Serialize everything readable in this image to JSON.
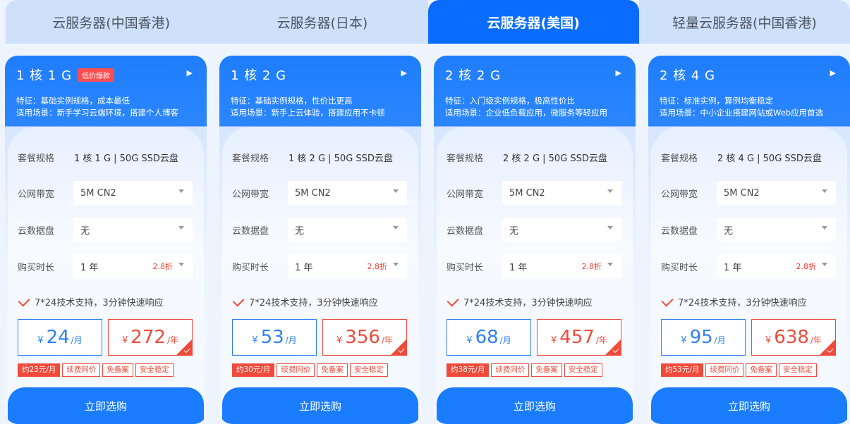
{
  "tabs": [
    {
      "label": "云服务器(中国香港)"
    },
    {
      "label": "云服务器(日本)"
    },
    {
      "label": "云服务器(美国)"
    },
    {
      "label": "轻量云服务器(中国香港)"
    }
  ],
  "labels": {
    "spec": "套餐规格",
    "bandwidth": "公网带宽",
    "disk": "云数据盘",
    "duration": "购买时长",
    "support": "7*24技术支持，3分钟快速响应",
    "currency": "¥",
    "per_month": "/月",
    "per_year": "/年",
    "buy": "立即选购",
    "tag_renew": "续费同价",
    "tag_nofiling": "免备案",
    "tag_stable": "安全稳定"
  },
  "cards": [
    {
      "title": "1 核 1 G",
      "badge": "低价爆款",
      "feature": "特征：基础实例规格，成本最低",
      "scene": "适用场景：新手学习云端环境，搭建个人博客",
      "spec": "1 核 1 G | 50G SSD云盘",
      "bandwidth": "5M CN2",
      "disk": "无",
      "duration": "1 年",
      "discount": "2.8折",
      "month_price": "24",
      "year_price": "272",
      "tag_month": "约23元/月"
    },
    {
      "title": "1 核 2 G",
      "badge": "",
      "feature": "特征：基础实例规格，性价比更高",
      "scene": "适用场景：新手上云体验，搭建应用不卡顿",
      "spec": "1 核 2 G | 50G SSD云盘",
      "bandwidth": "5M CN2",
      "disk": "无",
      "duration": "1 年",
      "discount": "2.8折",
      "month_price": "53",
      "year_price": "356",
      "tag_month": "约30元/月"
    },
    {
      "title": "2 核 2 G",
      "badge": "",
      "feature": "特征：入门级实例规格，极高性价比",
      "scene": "适用场景：企业低负载应用，微服务等轻应用",
      "spec": "2 核 2 G | 50G SSD云盘",
      "bandwidth": "5M CN2",
      "disk": "无",
      "duration": "1 年",
      "discount": "2.8折",
      "month_price": "68",
      "year_price": "457",
      "tag_month": "约38元/月"
    },
    {
      "title": "2 核 4 G",
      "badge": "",
      "feature": "特征：标准实例，算例均衡稳定",
      "scene": "适用场景：中小企业搭建网站或Web应用首选",
      "spec": "2 核 4 G | 50G SSD云盘",
      "bandwidth": "5M CN2",
      "disk": "无",
      "duration": "1 年",
      "discount": "2.8折",
      "month_price": "95",
      "year_price": "638",
      "tag_month": "约53元/月"
    }
  ],
  "colors": {
    "primary": "#0a6cff",
    "accent": "#f04a3a",
    "tab_bg": "#cfe0fb"
  },
  "active_tab_index": 2
}
